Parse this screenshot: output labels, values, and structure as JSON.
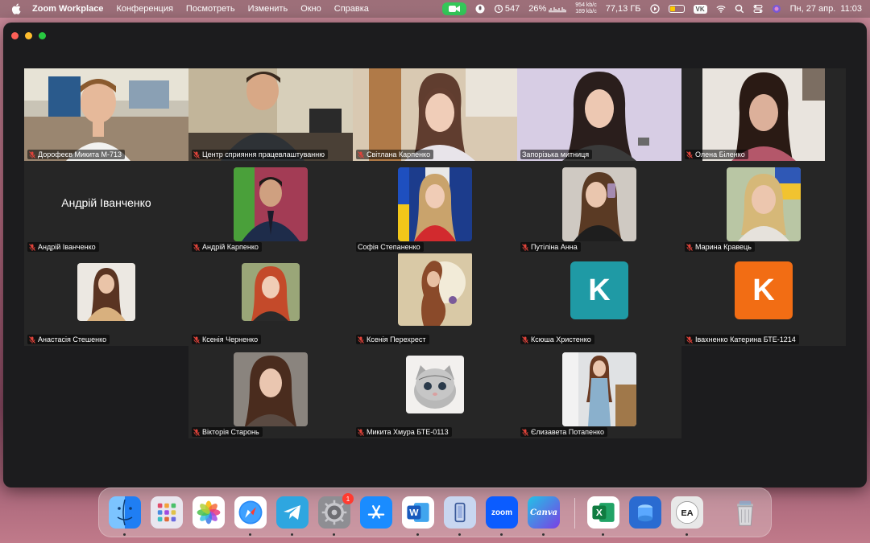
{
  "menubar": {
    "app_name": "Zoom Workplace",
    "menu_items": [
      "Конференция",
      "Посмотреть",
      "Изменить",
      "Окно",
      "Справка"
    ],
    "cpu_count": "547",
    "cpu_percent": "26%",
    "net_up": "954 kb/c",
    "net_down": "189 kb/c",
    "disk_free": "77,13 ГБ",
    "vk_label": "VK",
    "date": "Пн, 27 апр.",
    "time": "11:03"
  },
  "participants": [
    {
      "name": "Дорофеєв Микита М-713",
      "kind": "video",
      "muted": true
    },
    {
      "name": "Центр сприяння працевлаштуванню",
      "kind": "video",
      "muted": true
    },
    {
      "name": "Світлана Карпенко",
      "kind": "video",
      "muted": true
    },
    {
      "name": "Запорізька митниця",
      "kind": "video",
      "muted": false,
      "active": true
    },
    {
      "name": "Олена Біленко",
      "kind": "video",
      "muted": true
    },
    {
      "name": "Андрій Іванченко",
      "kind": "name-only",
      "muted": true
    },
    {
      "name": "Андрій Карпенко",
      "kind": "photo",
      "muted": true
    },
    {
      "name": "Софія Степаненко",
      "kind": "photo",
      "muted": false
    },
    {
      "name": "Путіліна Анна",
      "kind": "photo",
      "muted": true
    },
    {
      "name": "Марина Кравець",
      "kind": "photo",
      "muted": true
    },
    {
      "name": "Анастасія Стешенко",
      "kind": "photo",
      "muted": true
    },
    {
      "name": "Ксенія Черненко",
      "kind": "photo",
      "muted": true
    },
    {
      "name": "Ксенія Перехрест",
      "kind": "photo",
      "muted": true
    },
    {
      "name": "Ксюша Христенко",
      "kind": "letter",
      "letter": "K",
      "color": "#1f9aa5",
      "muted": true
    },
    {
      "name": "Івахненко Катерина БТЕ-1214",
      "kind": "letter",
      "letter": "K",
      "color": "#f26d14",
      "muted": true
    },
    {
      "name": "Вікторія Старонь",
      "kind": "photo",
      "muted": true
    },
    {
      "name": "Микита Хмура БТЕ-0113",
      "kind": "photo",
      "muted": true
    },
    {
      "name": "Єлизавета Потапенко",
      "kind": "photo",
      "muted": true
    }
  ],
  "dock": {
    "apps": [
      {
        "name": "Finder",
        "color": "#2f8ef7",
        "glyph": ""
      },
      {
        "name": "Launchpad",
        "color": "#e9e6ef",
        "glyph": ""
      },
      {
        "name": "Photos",
        "color": "#ffffff",
        "glyph": ""
      },
      {
        "name": "Safari",
        "color": "#ffffff",
        "glyph": ""
      },
      {
        "name": "Telegram",
        "color": "#2ea6e0",
        "glyph": ""
      },
      {
        "name": "System Settings",
        "color": "#8e8e93",
        "glyph": "",
        "badge": "1"
      },
      {
        "name": "App Store",
        "color": "#1a8cff",
        "glyph": ""
      },
      {
        "name": "Word",
        "color": "#ffffff",
        "glyph": "W"
      },
      {
        "name": "iPhone Mirroring",
        "color": "#c8d6f0",
        "glyph": ""
      },
      {
        "name": "Zoom",
        "color": "#0b5cff",
        "glyph": "zoom"
      },
      {
        "name": "Canva",
        "color": "#7b3fe4",
        "glyph": "Canva"
      },
      {
        "name": "Excel",
        "color": "#ffffff",
        "glyph": "X"
      },
      {
        "name": "Apps",
        "color": "#2a6bd1",
        "glyph": ""
      },
      {
        "name": "EA",
        "color": "#e8e8e8",
        "glyph": "EA"
      },
      {
        "name": "Trash",
        "color": "#d9d9dc",
        "glyph": ""
      }
    ]
  }
}
